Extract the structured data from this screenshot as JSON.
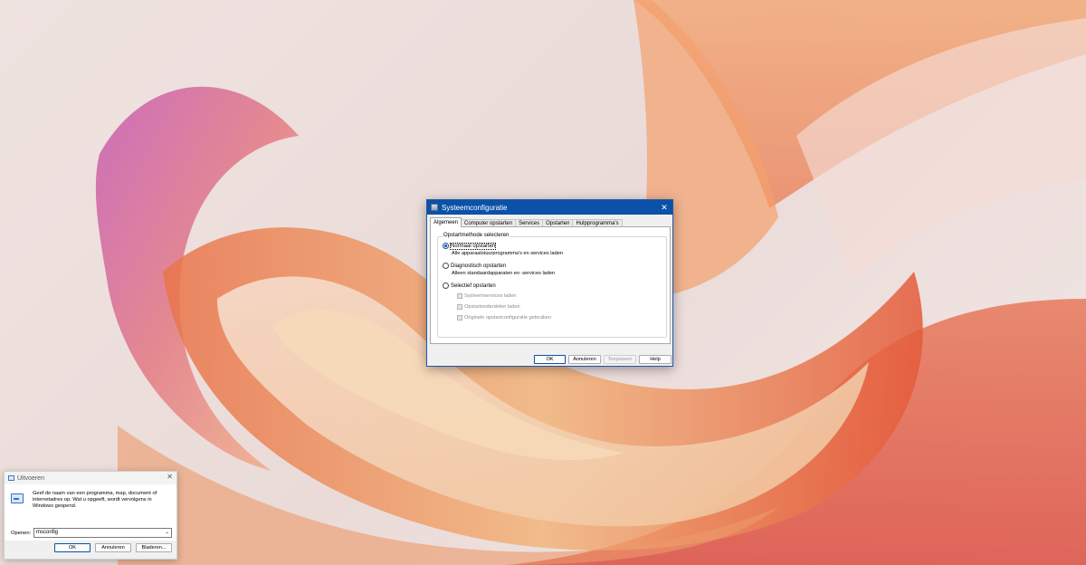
{
  "msconfig": {
    "title": "Systeemconfiguratie",
    "close_glyph": "✕",
    "tabs": [
      "Algemeen",
      "Computer opstarten",
      "Services",
      "Opstarten",
      "Hulpprogramma's"
    ],
    "groupbox_title": "Opstartmethode selecteren",
    "options": [
      {
        "label": "Normaal opstarten",
        "description": "Alle apparaatstuurprogramma's en services laden",
        "checked": true
      },
      {
        "label": "Diagnostisch opstarten",
        "description": "Alleen standaardapparaten en -services laden",
        "checked": false
      },
      {
        "label": "Selectief opstarten",
        "description": "",
        "checked": false
      }
    ],
    "selective_items": [
      "Systeemservices laden",
      "Opstartonderdelen laden",
      "Originele opstartconfiguratie gebruiken"
    ],
    "buttons": {
      "ok": "OK",
      "cancel": "Annuleren",
      "apply": "Toepassen",
      "help": "Help"
    }
  },
  "run": {
    "title": "Uitvoeren",
    "close_glyph": "✕",
    "description": "Geef de naam van een programma, map, document of internetadres op. Wat u opgeeft, wordt vervolgens in Windows geopend.",
    "open_label": "Openen:",
    "input_value": "msconfig",
    "dropdown_glyph": "⌄",
    "buttons": {
      "ok": "OK",
      "cancel": "Annuleren",
      "browse": "Bladeren..."
    }
  }
}
